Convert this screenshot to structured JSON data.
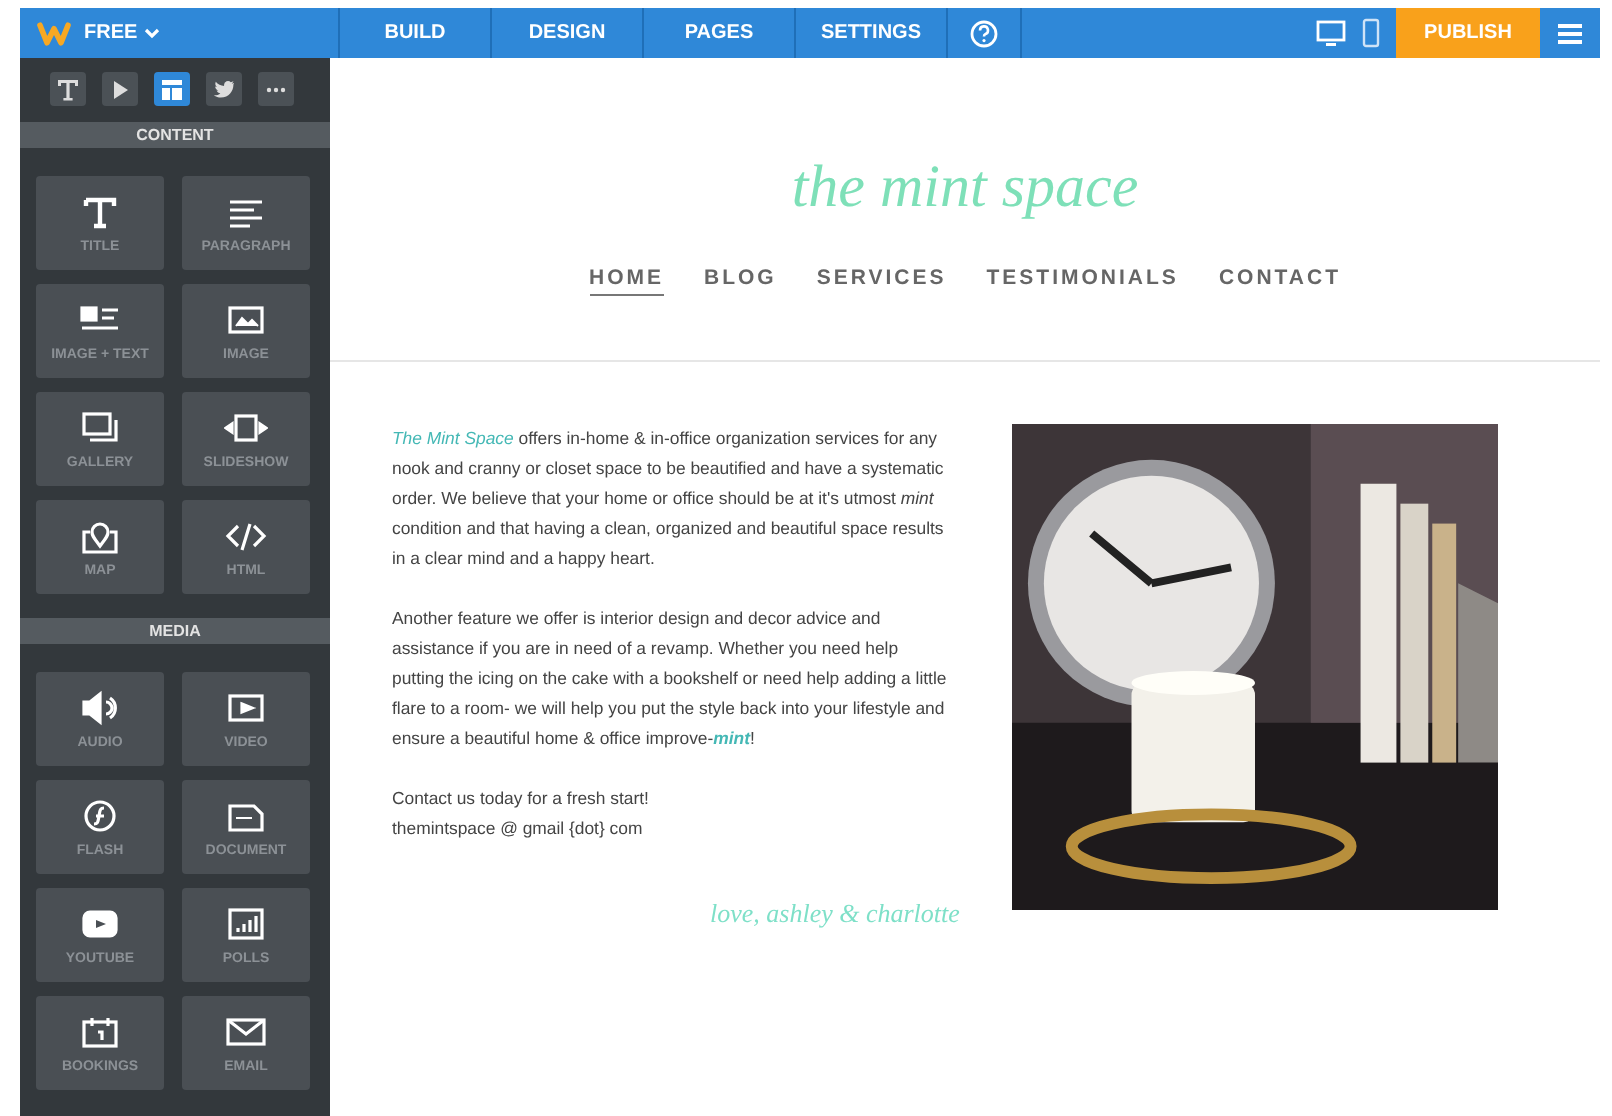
{
  "topbar": {
    "plan": "FREE",
    "tabs": [
      {
        "label": "BUILD"
      },
      {
        "label": "DESIGN"
      },
      {
        "label": "PAGES"
      },
      {
        "label": "SETTINGS"
      }
    ],
    "publish": "PUBLISH"
  },
  "sidebar": {
    "tools": [
      {
        "selected": false
      },
      {
        "selected": false
      },
      {
        "selected": true
      },
      {
        "selected": false
      },
      {
        "selected": false
      }
    ],
    "sections": [
      {
        "title": "CONTENT",
        "items": [
          "TITLE",
          "PARAGRAPH",
          "IMAGE + TEXT",
          "IMAGE",
          "GALLERY",
          "SLIDESHOW",
          "MAP",
          "HTML"
        ]
      },
      {
        "title": "MEDIA",
        "items": [
          "AUDIO",
          "VIDEO",
          "FLASH",
          "DOCUMENT",
          "YOUTUBE",
          "POLLS",
          "BOOKINGS",
          "EMAIL"
        ]
      }
    ]
  },
  "site": {
    "logo": "the mint space",
    "nav": [
      {
        "label": "HOME",
        "selected": true
      },
      {
        "label": "BLOG",
        "selected": false
      },
      {
        "label": "SERVICES",
        "selected": false
      },
      {
        "label": "TESTIMONIALS",
        "selected": false
      },
      {
        "label": "CONTACT",
        "selected": false
      }
    ],
    "paragraphs": [
      "*The Mint Space* offers in-home & in-office organization services for any nook and cranny or closet space to be beautified and have a systematic order. We believe that your home or office should be at it's utmost *mint* condition and that having a clean, organized and beautiful space results in a clear mind and a happy heart.",
      "Another feature we offer is interior design and decor advice and assistance if you are in need of a revamp. Whether you need help putting the icing on the cake with a bookshelf or need help adding a little flare to a room- we will help you put the style back into your lifestyle and ensure a beautiful home & office improve-**mint**!",
      "Contact us today for a fresh start!",
      "themintspace @ gmail {dot} com"
    ],
    "signature": "love, ashley & charlotte",
    "photo": {
      "kind": "picture"
    }
  }
}
